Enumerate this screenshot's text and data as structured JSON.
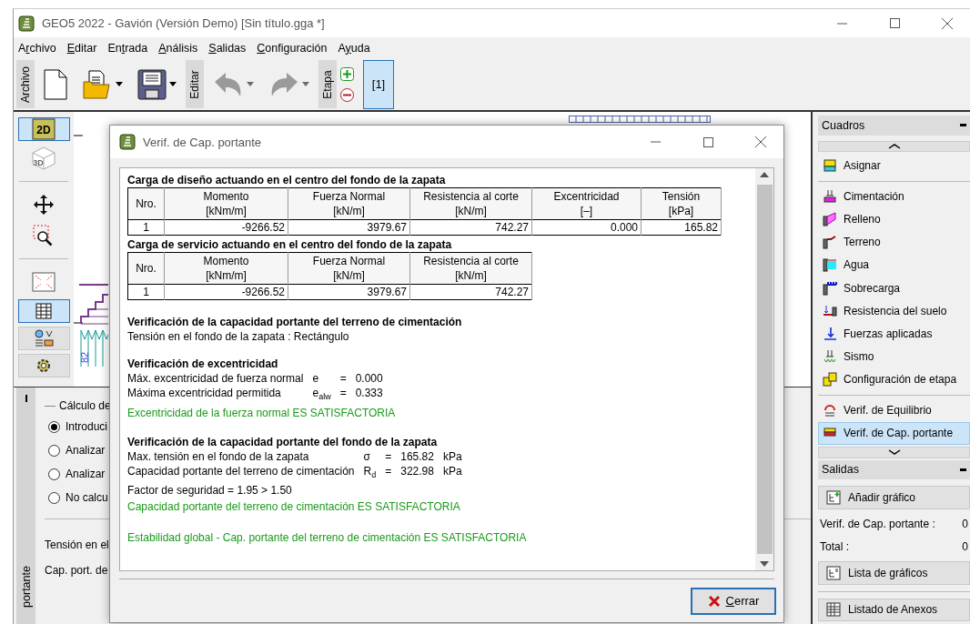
{
  "window": {
    "title": "GEO5 2022 - Gavión (Versión Demo) [Sin título.gga *]"
  },
  "menu": [
    {
      "pre": "A",
      "key": "r",
      "post": "chivo"
    },
    {
      "key": "E",
      "post": "ditar"
    },
    {
      "pre": "En",
      "key": "t",
      "post": "rada"
    },
    {
      "key": "A",
      "post": "nálisis"
    },
    {
      "key": "S",
      "post": "alidas"
    },
    {
      "key": "C",
      "post": "onfiguración"
    },
    {
      "pre": "A",
      "key": "y",
      "post": "uda"
    }
  ],
  "toolbar": [
    {
      "label": "Archivo",
      "tools": [
        {
          "kind": "new",
          "dropdown": false,
          "disabled": false
        },
        {
          "kind": "open",
          "dropdown": true,
          "disabled": false
        },
        {
          "kind": "save",
          "dropdown": true,
          "disabled": false
        }
      ]
    },
    {
      "label": "Editar",
      "tools": [
        {
          "kind": "undo",
          "dropdown": true,
          "disabled": true
        },
        {
          "kind": "redo",
          "dropdown": true,
          "disabled": true
        }
      ]
    },
    {
      "label": "Etapa",
      "tools": [
        {
          "kind": "stack",
          "tools": [
            {
              "kind": "add"
            },
            {
              "kind": "remove"
            }
          ]
        },
        {
          "kind": "stage",
          "label": "[1]",
          "selected": true
        }
      ]
    }
  ],
  "left_tools": [
    {
      "kind": "plan",
      "label": "2D",
      "selected": true,
      "framed": true,
      "disabled": false
    },
    {
      "kind": "perspective",
      "label": "3D",
      "selected": false,
      "framed": false,
      "disabled": true
    },
    {
      "kind": "separator"
    },
    {
      "kind": "move",
      "selected": false,
      "framed": false,
      "disabled": false
    },
    {
      "kind": "zoom",
      "selected": false,
      "framed": false,
      "disabled": false
    },
    {
      "kind": "separator"
    },
    {
      "kind": "fit",
      "selected": false,
      "framed": false,
      "disabled": false
    },
    {
      "kind": "table",
      "selected": true,
      "framed": true,
      "disabled": false
    },
    {
      "kind": "labels",
      "selected": false,
      "framed": true,
      "disabled": false
    },
    {
      "kind": "settings",
      "selected": false,
      "framed": true,
      "disabled": false
    }
  ],
  "canvas": {
    "dimension": "82"
  },
  "bottom_panel": {
    "tab": "portante",
    "group": "Cálculo de",
    "options": [
      {
        "label": "Introduci",
        "selected": true
      },
      {
        "label": "Analizar",
        "selected": false
      },
      {
        "label": "Analizar",
        "selected": false
      },
      {
        "label": "No calcu",
        "selected": false
      }
    ],
    "fields": [
      "Tensión en el",
      "Cap. port. de"
    ]
  },
  "dialog": {
    "title": "Verif. de Cap. portante",
    "report": [
      {
        "kind": "heading",
        "text": "Carga de diseño actuando en el centro del fondo de la zapata"
      },
      {
        "kind": "table",
        "columns": [
          {
            "name": "Nro."
          },
          {
            "name": "Momento",
            "unit": "[kNm/m]"
          },
          {
            "name": "Fuerza Normal",
            "unit": "[kN/m]"
          },
          {
            "name": "Resistencia al corte",
            "unit": "[kN/m]"
          },
          {
            "name": "Excentricidad",
            "unit": "[–]"
          },
          {
            "name": "Tensión",
            "unit": "[kPa]"
          }
        ],
        "rows": [
          [
            "1",
            "-9266.52",
            "3979.67",
            "742.27",
            "0.000",
            "165.82"
          ]
        ]
      },
      {
        "kind": "heading",
        "text": "Carga de servicio actuando en el centro del fondo de la zapata"
      },
      {
        "kind": "table",
        "columns": [
          {
            "name": "Nro."
          },
          {
            "name": "Momento",
            "unit": "[kNm/m]"
          },
          {
            "name": "Fuerza Normal",
            "unit": "[kN/m]"
          },
          {
            "name": "Resistencia al corte",
            "unit": "[kN/m]"
          }
        ],
        "rows": [
          [
            "1",
            "-9266.52",
            "3979.67",
            "742.27"
          ]
        ]
      },
      {
        "kind": "gap"
      },
      {
        "kind": "heading",
        "text": "Verificación de la capacidad portante del terreno de cimentación"
      },
      {
        "kind": "text",
        "text": "Tensión en el fondo de la zapata : Rectángulo"
      },
      {
        "kind": "gap"
      },
      {
        "kind": "heading",
        "text": "Verificación de excentricidad"
      },
      {
        "kind": "quantities",
        "rows": [
          {
            "label": "Máx. excentricidad de fuerza normal",
            "symbol": "e",
            "relation": "=",
            "value": "0.000"
          },
          {
            "label": "Máxima excentricidad permitida",
            "symbol": "e$_{alw}$",
            "relation": "=",
            "value": "0.333"
          }
        ]
      },
      {
        "kind": "ok",
        "text": "Excentricidad de la fuerza normal ES SATISFACTORIA"
      },
      {
        "kind": "gap"
      },
      {
        "kind": "heading",
        "text": "Verificación de la capacidad portante del fondo de la zapata"
      },
      {
        "kind": "quantities",
        "rows": [
          {
            "label": "Max. tensión en el fondo de la zapata",
            "symbol": "σ",
            "relation": "=",
            "value": "165.82",
            "unit": "kPa"
          },
          {
            "label": "Capacidad portante del terreno de cimentación",
            "symbol": "R$_{d}$",
            "relation": "=",
            "value": "322.98",
            "unit": "kPa"
          }
        ]
      },
      {
        "kind": "text",
        "text": "Factor de seguridad = 1.95 > 1.50"
      },
      {
        "kind": "ok",
        "text": "Capacidad portante del terreno de cimentación ES SATISFACTORIA"
      },
      {
        "kind": "gap"
      },
      {
        "kind": "ok",
        "text": "Estabilidad global - Cap. portante del terreno de cimentación ES SATISFACTORIA"
      }
    ],
    "close_button": {
      "key": "C",
      "post": "errar"
    }
  },
  "right_panel": [
    {
      "title": "Cuadros",
      "items": [
        {
          "kind": "scroll-up"
        },
        {
          "kind": "item",
          "label": "Asignar",
          "selected": false
        },
        {
          "kind": "separator"
        },
        {
          "kind": "item",
          "label": "Cimentación",
          "selected": false
        },
        {
          "kind": "item",
          "label": "Relleno",
          "selected": false
        },
        {
          "kind": "item",
          "label": "Terreno",
          "selected": false
        },
        {
          "kind": "item",
          "label": "Agua",
          "selected": false
        },
        {
          "kind": "item",
          "label": "Sobrecarga",
          "selected": false
        },
        {
          "kind": "item",
          "label": "Resistencia del suelo",
          "selected": false
        },
        {
          "kind": "item",
          "label": "Fuerzas aplicadas",
          "selected": false
        },
        {
          "kind": "item",
          "label": "Sismo",
          "selected": false
        },
        {
          "kind": "item",
          "label": "Configuración de etapa",
          "selected": false
        },
        {
          "kind": "separator"
        },
        {
          "kind": "item",
          "label": "Verif. de Equilibrio",
          "selected": false
        },
        {
          "kind": "item",
          "label": "Verif. de Cap. portante",
          "selected": true
        },
        {
          "kind": "scroll-down"
        }
      ]
    },
    {
      "title": "Salidas",
      "items": [
        {
          "kind": "button",
          "label": "Añadir gráfico"
        },
        {
          "kind": "count",
          "label": "Verif. de Cap. portante :",
          "value": "0"
        },
        {
          "kind": "count",
          "label": "Total :",
          "value": "0"
        },
        {
          "kind": "button",
          "label": "Lista de gráficos"
        },
        {
          "kind": "separator"
        },
        {
          "kind": "button",
          "label": "Listado de Anexos"
        }
      ]
    }
  ]
}
